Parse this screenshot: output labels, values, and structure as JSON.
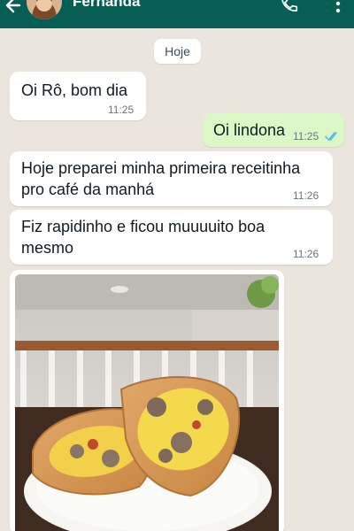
{
  "header": {
    "contact_name": "Fernanda",
    "back_icon": "arrow-left-icon",
    "call_icon": "phone-icon",
    "menu_icon": "more-vert-icon",
    "bg_color": "#075e54"
  },
  "date_chip": "Hoje",
  "messages": [
    {
      "direction": "incoming",
      "text": "Oi Rô, bom dia",
      "time": "11:25"
    },
    {
      "direction": "outgoing",
      "text": "Oi lindona",
      "time": "11:25",
      "status": "read"
    },
    {
      "direction": "incoming",
      "lines": [
        "Hoje preparei minha primeira receitinha",
        "pro café da manhá"
      ],
      "time": "11:26"
    },
    {
      "direction": "incoming",
      "lines": [
        "Fiz rapidinho e ficou muuuuito boa",
        "mesmo"
      ],
      "time": "11:26"
    },
    {
      "direction": "incoming",
      "type": "image",
      "image_content": "breakfast-burrito-photo"
    }
  ],
  "colors": {
    "chat_background": "#ece5dd",
    "incoming_bubble": "#ffffff",
    "outgoing_bubble": "#dcf8c6",
    "read_ticks": "#53bdeb"
  }
}
